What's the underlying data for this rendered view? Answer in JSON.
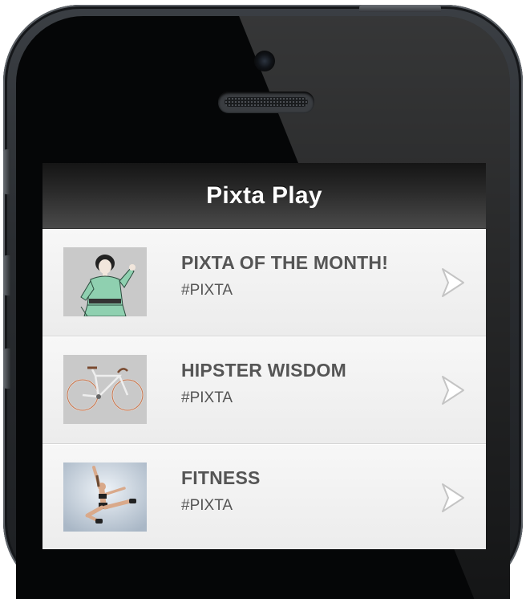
{
  "app": {
    "title": "Pixta Play"
  },
  "list": [
    {
      "title": "PIXTA OF THE MONTH!",
      "subtitle": "#PIXTA",
      "thumbnail": "retro-woman-image"
    },
    {
      "title": "HIPSTER WISDOM",
      "subtitle": "#PIXTA",
      "thumbnail": "bicycle-image"
    },
    {
      "title": "FITNESS",
      "subtitle": "#PIXTA",
      "thumbnail": "dancer-image"
    }
  ],
  "icons": {
    "disclosure": "chevron-right-icon"
  },
  "colors": {
    "navbar_top": "#151515",
    "navbar_bottom": "#4a4a4a",
    "row_text": "#555555",
    "row_bg": "#f4f4f4"
  }
}
